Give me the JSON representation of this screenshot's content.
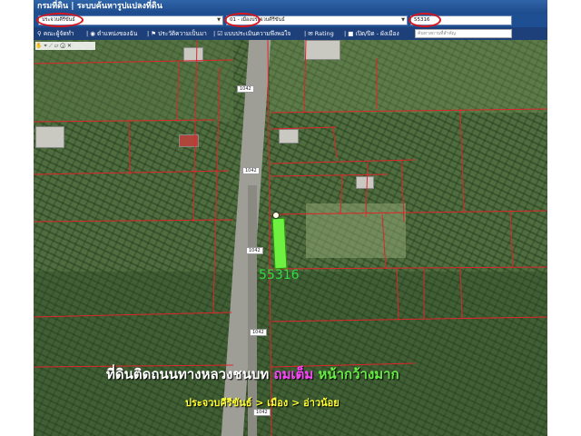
{
  "window": {
    "title": "กรมที่ดิน | ระบบค้นหารูปแปลงที่ดิน"
  },
  "selectors": {
    "province": "ประจวบคีรีขันธ์",
    "district": "01 - เมืองประจวบคีรีขันธ์",
    "parcel_no": "55316"
  },
  "menu": {
    "items": [
      "คณะผู้จัดทำ",
      "ตำแหน่งของฉัน",
      "ประวัติความเป็นมา",
      "แบบประเมินความพึงพอใจ",
      "Rating",
      "เปิด/ปิด - ผังเมือง"
    ],
    "search_placeholder": "ค้นหาสถานที่สำคัญ"
  },
  "map": {
    "road_labels": [
      "1042",
      "1042",
      "1042",
      "1042",
      "1042"
    ],
    "parcel_label": "55316",
    "highlight_color": "#6df040"
  },
  "overlay": {
    "headline_white": "ที่ดินติดถนนทางหลวงชนบท",
    "headline_pink": "ถมเต็ม",
    "headline_green": "หน้ากว้างมาก",
    "subline": "ประจวบคีรีขันธ์ > เมือง > อ่าวน้อย"
  }
}
